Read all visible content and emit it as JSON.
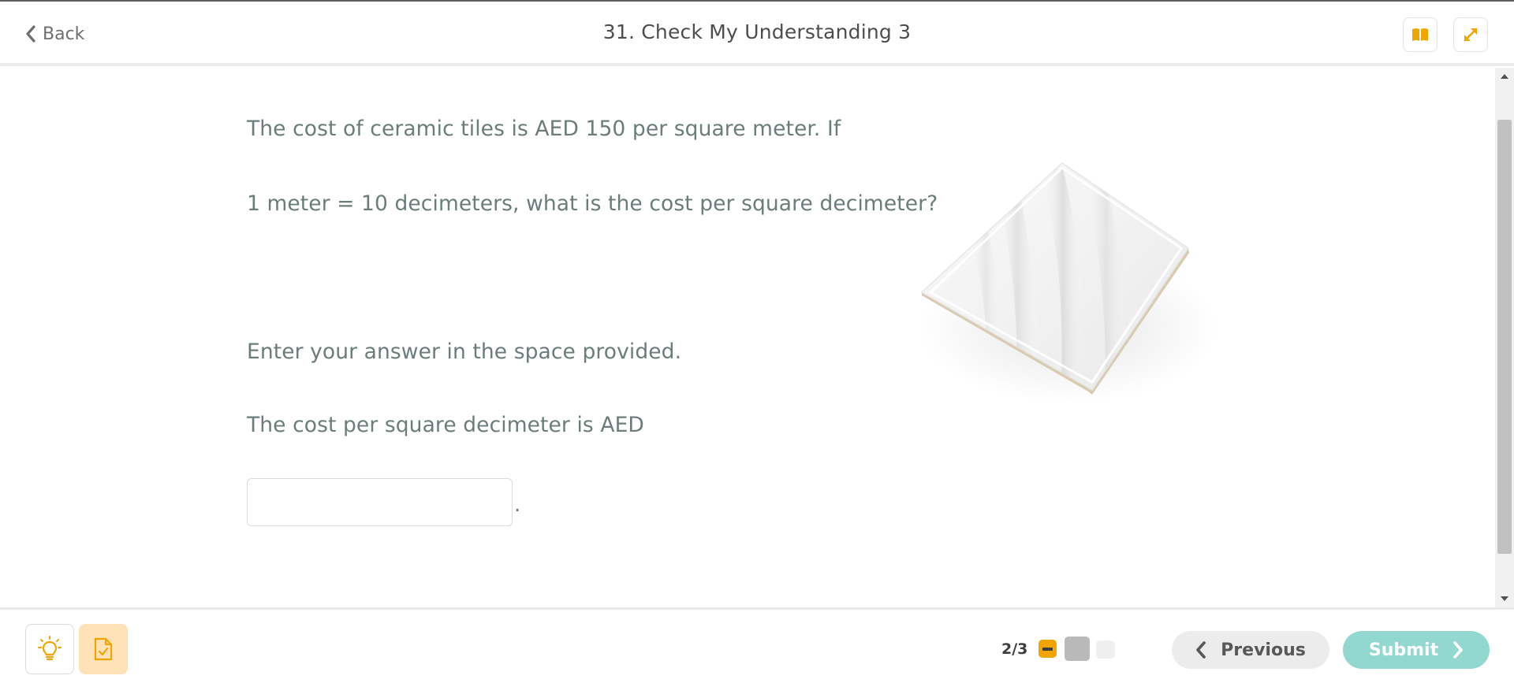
{
  "header": {
    "back_label": "Back",
    "title": "31. Check My Understanding 3"
  },
  "question": {
    "line1": "The cost of ceramic tiles is AED 150 per square meter. If",
    "line2": "1 meter = 10 decimeters, what is the cost per square decimeter?",
    "instruction": "Enter your answer in the space provided.",
    "prompt": "The cost per square decimeter is AED",
    "answer_value": "",
    "answer_suffix": "."
  },
  "footer": {
    "pager_text": "2/3",
    "previous_label": "Previous",
    "submit_label": "Submit"
  },
  "colors": {
    "accent_orange": "#f0a500",
    "submit_teal": "#92d7d0",
    "text_slate": "#6a7d7b"
  }
}
